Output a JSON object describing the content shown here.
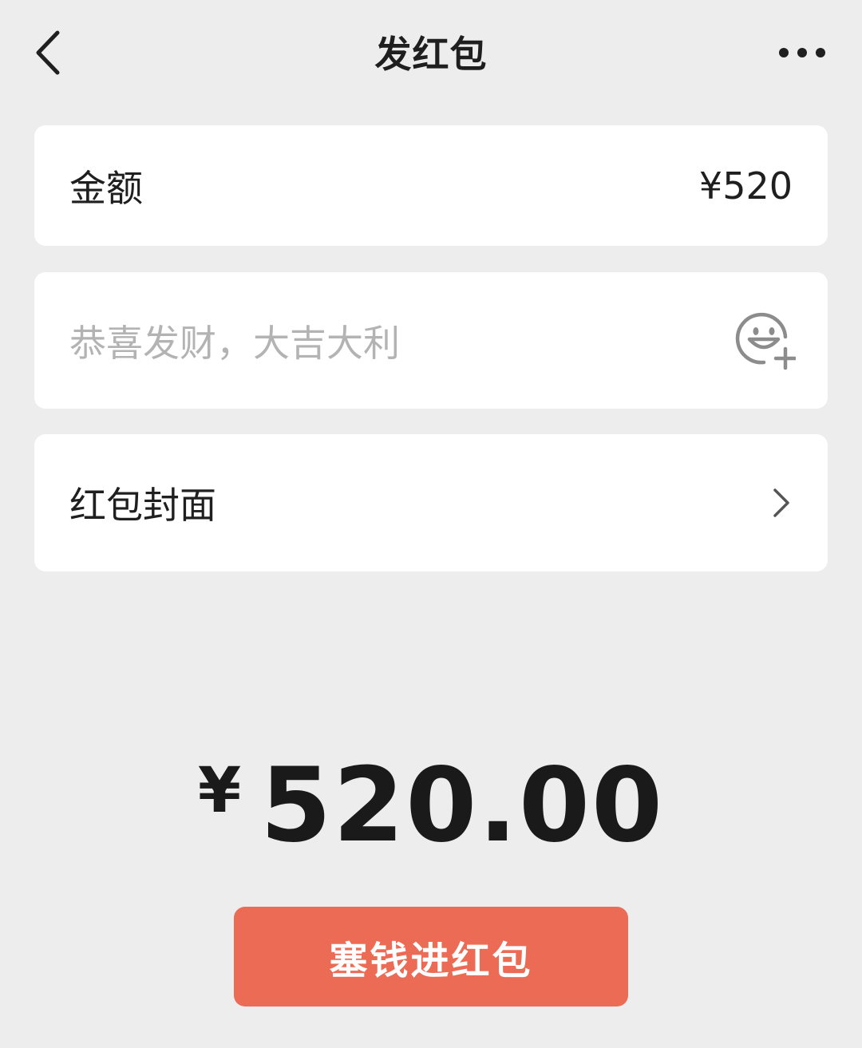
{
  "header": {
    "title": "发红包",
    "back_icon": "chevron-left-icon",
    "more_icon": "more-horizontal-icon"
  },
  "amount": {
    "label": "金额",
    "value": "¥520"
  },
  "message": {
    "placeholder": "恭喜发财，大吉大利",
    "emoji_icon": "emoji-add-icon"
  },
  "cover": {
    "label": "红包封面",
    "chevron_icon": "chevron-right-icon"
  },
  "total": {
    "currency": "¥",
    "value": "520.00"
  },
  "submit": {
    "label": "塞钱进红包"
  },
  "colors": {
    "background": "#ededed",
    "card": "#ffffff",
    "primary_button": "#eb6b54",
    "placeholder_text": "#b3b3b3"
  }
}
